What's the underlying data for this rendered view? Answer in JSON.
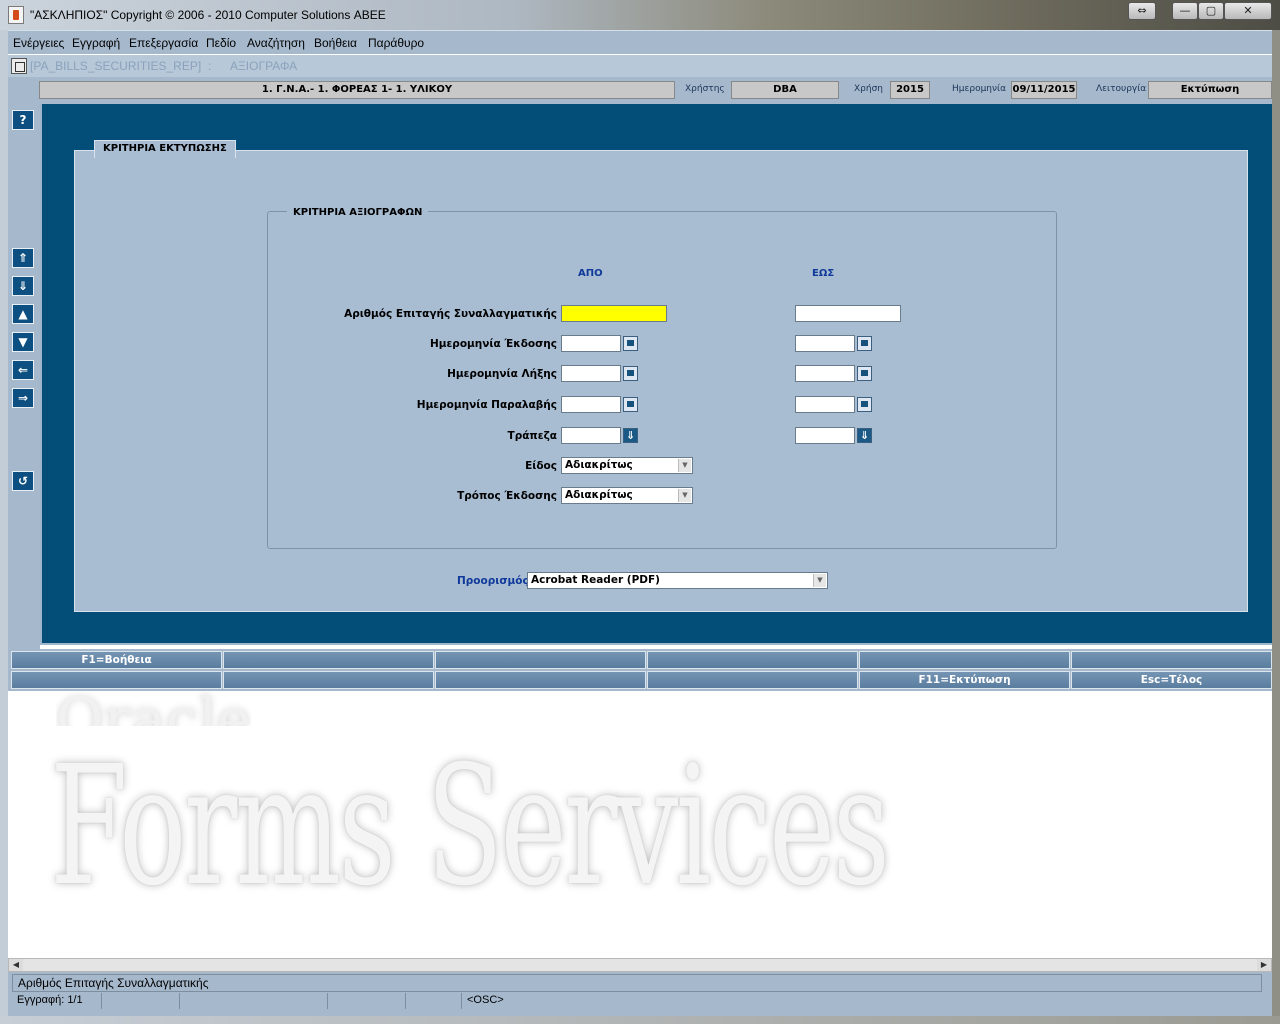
{
  "window": {
    "title": "\"ΑΣΚΛΗΠΙΟΣ\" Copyright © 2006 - 2010 Computer Solutions ΑΒΕΕ",
    "buttons": {
      "swap": "⇔",
      "minimize": "—",
      "maximize": "▢",
      "close": "✕"
    }
  },
  "menu": [
    "Ενέργειες",
    "Εγγραφή",
    "Επεξεργασία",
    "Πεδίο",
    "Αναζήτηση",
    "Βοήθεια",
    "Παράθυρο"
  ],
  "form_path": {
    "name": "[PA_BILLS_SECURITIES_REP]",
    "separator": ":",
    "title": "ΑΞΙΟΓΡΑΦΑ"
  },
  "info": {
    "organization": "1. Γ.Ν.Α.- 1. ΦΟΡΕΑΣ 1- 1. ΥΛΙΚΟΥ",
    "user_label": "Χρήστης",
    "user": "DBA",
    "year_label": "Χρήση",
    "year": "2015",
    "date_label": "Ημερομηνία",
    "date": "09/11/2015",
    "function_label": "Λειτουργία",
    "function": "Εκτύπωση"
  },
  "left_toolbar": {
    "help": "?",
    "first": "⇑",
    "last": "⇓",
    "prev": "▲",
    "next": "▼",
    "left": "⇐",
    "right": "⇒",
    "back": "↺"
  },
  "form": {
    "tab_label": "ΚΡΙΤΗΡΙΑ ΕΚΤΥΠΩΣΗΣ",
    "group_label": "ΚΡΙΤΗΡΙΑ ΑΞΙΟΓΡΑΦΩΝ",
    "col_from": "ΑΠΟ",
    "col_to": "ΕΩΣ",
    "rows": [
      {
        "label": "Αριθμός Επιταγής Συναλλαγματικής",
        "from": "",
        "to": ""
      },
      {
        "label": "Ημερομηνία Έκδοσης",
        "from": "",
        "to": ""
      },
      {
        "label": "Ημερομηνία Λήξης",
        "from": "",
        "to": ""
      },
      {
        "label": "Ημερομηνία Παραλαβής",
        "from": "",
        "to": ""
      },
      {
        "label": "Τράπεζα",
        "from": "",
        "to": ""
      }
    ],
    "type_label": "Είδος",
    "type_value": "Αδιακρίτως",
    "issue_mode_label": "Τρόπος Έκδοσης",
    "issue_mode_value": "Αδιακρίτως",
    "destination_label": "Προορισμός",
    "destination_value": "Acrobat Reader (PDF)",
    "highlight_color": "#ffff00"
  },
  "function_keys": {
    "row1": [
      "F1=Βοήθεια",
      "",
      "",
      "",
      "",
      ""
    ],
    "row2": [
      "",
      "",
      "",
      "",
      "F11=Εκτύπωση",
      "Esc=Τέλος"
    ]
  },
  "watermark": {
    "line1": "Oracle",
    "line2": "Forms Services"
  },
  "status": {
    "message": "Αριθμός Επιταγής Συναλλαγματικής",
    "record": "Εγγραφή: 1/1",
    "mode": "<OSC>"
  },
  "colors": {
    "panel": "#024e78",
    "frame": "#a8bcd2",
    "toolbar": "#a6b8cc",
    "accent_label": "#103a9a"
  }
}
